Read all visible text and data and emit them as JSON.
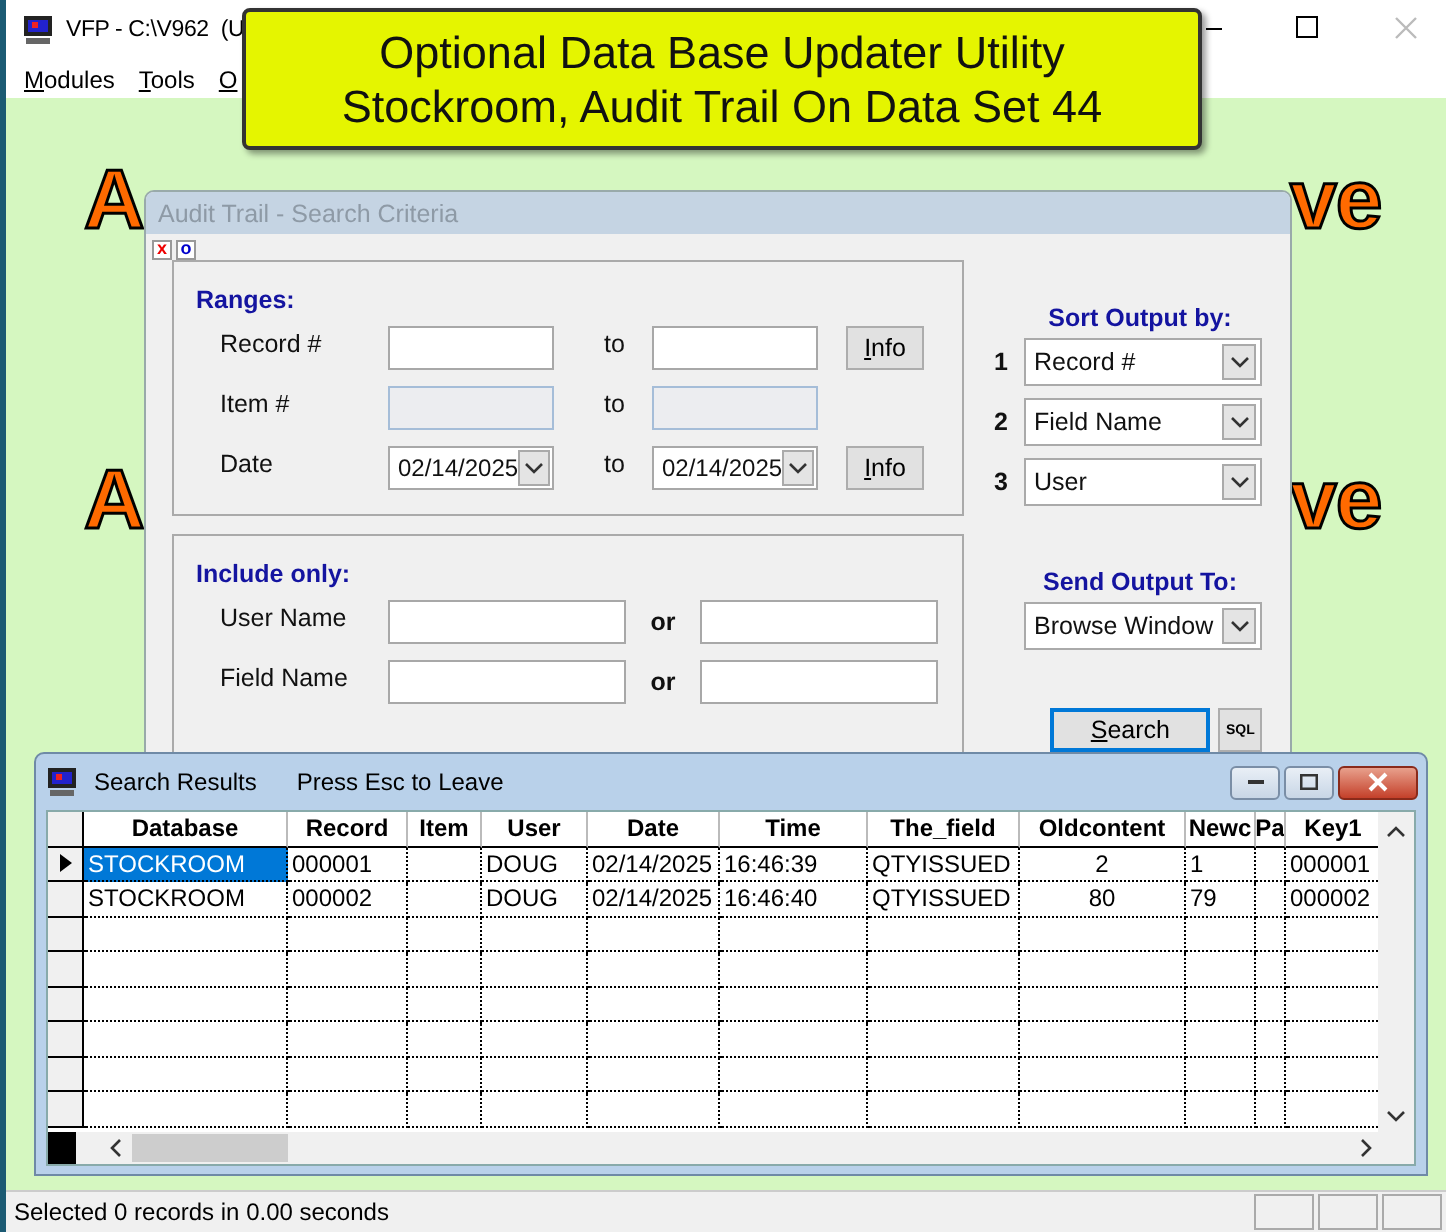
{
  "app_window": {
    "title": "VFP - C:\\V962  (U",
    "menu": [
      {
        "label": "Modules"
      },
      {
        "label": "Tools"
      },
      {
        "label": "O"
      }
    ]
  },
  "banner": {
    "lines": [
      "Optional Data Base Updater Utility",
      "Stockroom, Audit Trail On Data Set 44"
    ]
  },
  "desktop_text": [
    {
      "text": "A"
    },
    {
      "text": "ve"
    },
    {
      "text": "A"
    },
    {
      "text": "ve"
    }
  ],
  "search_dialog": {
    "title": "Audit Trail - Search Criteria",
    "active": false,
    "corner_buttons": [
      {
        "label": "x",
        "kind": "close"
      },
      {
        "label": "o",
        "kind": "option"
      }
    ],
    "ranges": {
      "heading": "Ranges:",
      "rows": [
        {
          "label": "Record #",
          "joiner": "to",
          "kind": "text",
          "disabled": false,
          "info": "Info"
        },
        {
          "label": "Item #",
          "joiner": "to",
          "kind": "text",
          "disabled": true
        },
        {
          "label": "Date",
          "joiner": "to",
          "kind": "date",
          "disabled": false,
          "from": "02/14/2025",
          "to": "02/14/2025",
          "info": "Info"
        }
      ]
    },
    "include": {
      "heading": "Include only:",
      "rows": [
        {
          "label": "User Name",
          "joiner": "or"
        },
        {
          "label": "Field Name",
          "joiner": "or"
        }
      ]
    },
    "sort": {
      "heading": "Sort Output by:",
      "items": [
        {
          "number": "1",
          "value": "Record #"
        },
        {
          "number": "2",
          "value": "Field Name"
        },
        {
          "number": "3",
          "value": "User"
        }
      ]
    },
    "output": {
      "heading": "Send Output To:",
      "value": "Browse Window"
    },
    "buttons": [
      {
        "label": "Search",
        "kind": "search",
        "focused": true
      },
      {
        "label": "SQL",
        "kind": "sql",
        "focused": false
      }
    ]
  },
  "results": {
    "title": "Search Results",
    "hint": "Press Esc to Leave",
    "columns": [
      {
        "label": "Database"
      },
      {
        "label": "Record"
      },
      {
        "label": "Item"
      },
      {
        "label": "User"
      },
      {
        "label": "Date"
      },
      {
        "label": "Time"
      },
      {
        "label": "The_field"
      },
      {
        "label": "Oldcontent"
      },
      {
        "label": "Newc"
      },
      {
        "label": "Pa"
      },
      {
        "label": "Key1"
      }
    ],
    "rows": [
      {
        "selected": true,
        "cells": [
          "STOCKROOM",
          "000001",
          null,
          "DOUG",
          "02/14/2025",
          "16:46:39",
          "QTYISSUED",
          "2",
          "1",
          null,
          "000001"
        ]
      },
      {
        "selected": false,
        "cells": [
          "STOCKROOM",
          "000002",
          null,
          "DOUG",
          "02/14/2025",
          "16:46:40",
          "QTYISSUED",
          "80",
          "79",
          null,
          "000002"
        ]
      }
    ]
  },
  "status_bar": {
    "text": "Selected 0 records in 0.00 seconds"
  }
}
